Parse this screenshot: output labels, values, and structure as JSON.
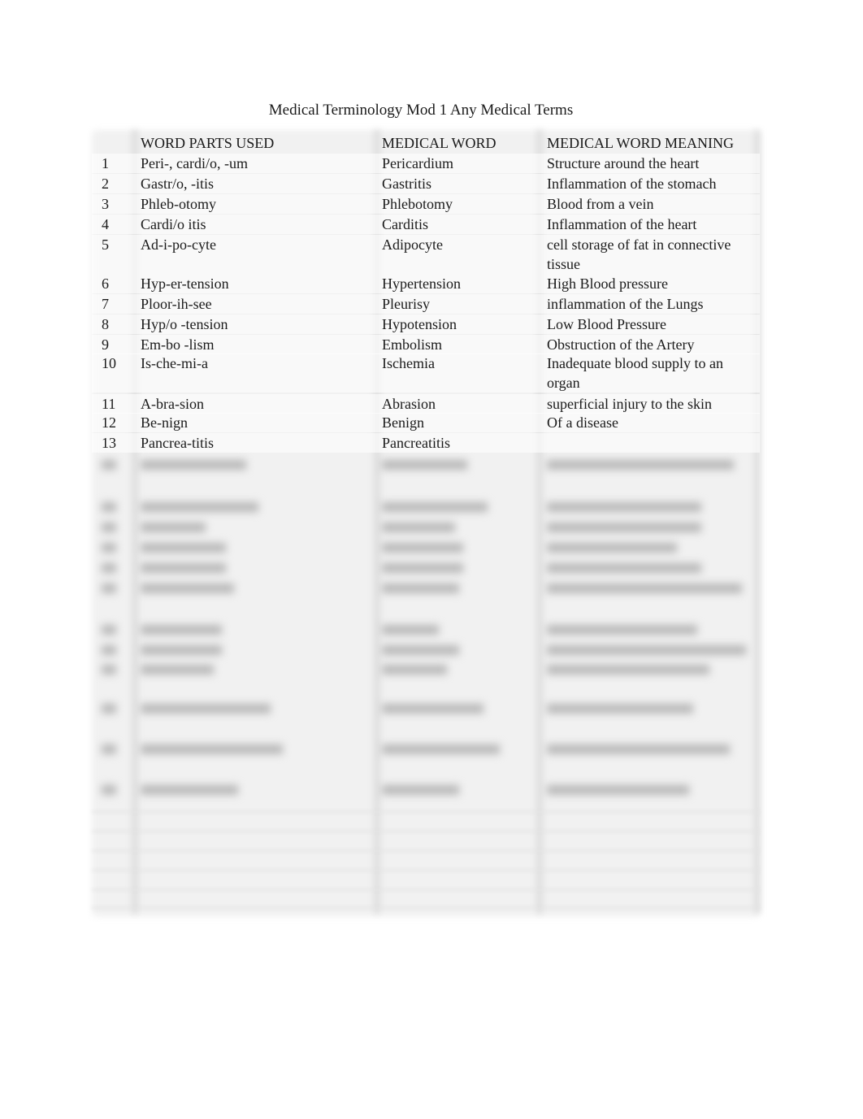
{
  "document": {
    "title": "Medical Terminology Mod 1 Any Medical Terms"
  },
  "table": {
    "headers": [
      "",
      "WORD PARTS USED",
      "MEDICAL WORD",
      "MEDICAL WORD MEANING"
    ],
    "rows": [
      {
        "num": "1",
        "parts": "Peri-, cardi/o, -um",
        "word": "Pericardium",
        "meaning": "Structure around the heart"
      },
      {
        "num": "2",
        "parts": "Gastr/o, -itis",
        "word": "Gastritis",
        "meaning": "Inflammation of the stomach"
      },
      {
        "num": "3",
        "parts": "Phleb-otomy",
        "word": "Phlebotomy",
        "meaning": "Blood from a vein"
      },
      {
        "num": "4",
        "parts": "Cardi/o itis",
        "word": "Carditis",
        "meaning": "Inflammation of the heart"
      },
      {
        "num": "5",
        "parts": "Ad-i-po-cyte",
        "word": "Adipocyte",
        "meaning": "cell storage of fat in connective tissue"
      },
      {
        "num": "6",
        "parts": "Hyp-er-tension",
        "word": "Hypertension",
        "meaning": "High Blood pressure"
      },
      {
        "num": "7",
        "parts": "Ploor-ih-see",
        "word": "Pleurisy",
        "meaning": "inflammation of the Lungs"
      },
      {
        "num": "8",
        "parts": "Hyp/o -tension",
        "word": "Hypotension",
        "meaning": "Low Blood Pressure"
      },
      {
        "num": "9",
        "parts": "Em-bo -lism",
        "word": "Embolism",
        "meaning": "Obstruction of the Artery"
      },
      {
        "num": "10",
        "parts": "Is-che-mi-a",
        "word": "Ischemia",
        "meaning": "Inadequate blood supply to an organ"
      },
      {
        "num": "11",
        "parts": "A-bra-sion",
        "word": "Abrasion",
        "meaning": "superficial injury to the skin"
      },
      {
        "num": "12",
        "parts": "Be-nign",
        "word": "Benign",
        "meaning": "Of a disease"
      },
      {
        "num": "13",
        "parts": "Pancrea-titis",
        "word": "Pancreatitis",
        "meaning": ""
      }
    ]
  }
}
